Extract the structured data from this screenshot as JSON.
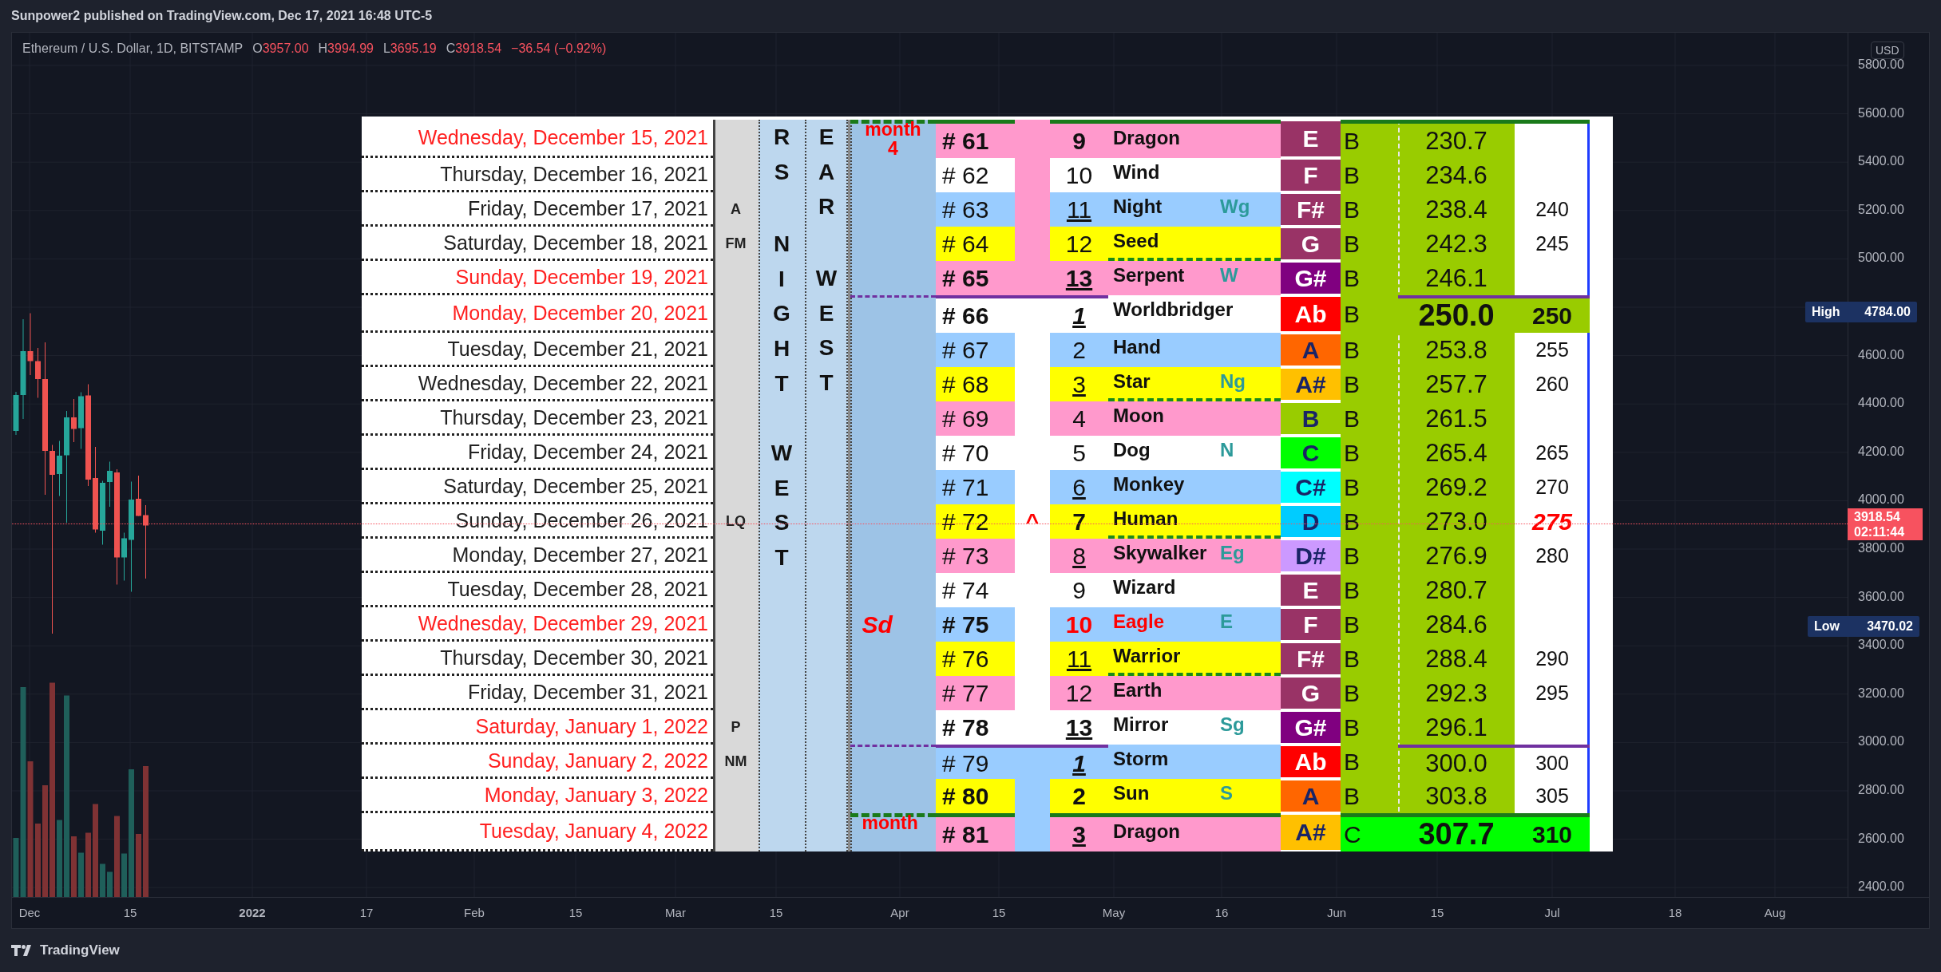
{
  "header": {
    "title": "Sunpower2 published on TradingView.com, Dec 17, 2021 16:48 UTC-5"
  },
  "legend": {
    "symbol": "Ethereum / U.S. Dollar, 1D, BITSTAMP",
    "values": [
      {
        "label": "O",
        "value": "3957.00"
      },
      {
        "label": "H",
        "value": "3994.99"
      },
      {
        "label": "L",
        "value": "3695.19"
      },
      {
        "label": "C",
        "value": "3918.54"
      }
    ],
    "change": "−36.54 (−0.92%)"
  },
  "price_axis": {
    "currency": "USD",
    "labels": [
      "5800.00",
      "5600.00",
      "5400.00",
      "5200.00",
      "5000.00",
      "4600.00",
      "4400.00",
      "4200.00",
      "4000.00",
      "3800.00",
      "3600.00",
      "3400.00",
      "3200.00",
      "3000.00",
      "2800.00",
      "2600.00",
      "2400.00"
    ],
    "high": {
      "label": "High",
      "value": "4784.00"
    },
    "last": {
      "price": "3918.54",
      "countdown": "02:11:44"
    },
    "low": {
      "label": "Low",
      "value": "3470.02"
    }
  },
  "time_axis": {
    "labels": [
      {
        "text": "Dec",
        "bold": false
      },
      {
        "text": "15",
        "bold": false
      },
      {
        "text": "2022",
        "bold": true
      },
      {
        "text": "17",
        "bold": false
      },
      {
        "text": "Feb",
        "bold": false
      },
      {
        "text": "15",
        "bold": false
      },
      {
        "text": "Mar",
        "bold": false
      },
      {
        "text": "15",
        "bold": false
      },
      {
        "text": "Apr",
        "bold": false
      },
      {
        "text": "15",
        "bold": false
      },
      {
        "text": "May",
        "bold": false
      },
      {
        "text": "16",
        "bold": false
      },
      {
        "text": "Jun",
        "bold": false
      },
      {
        "text": "15",
        "bold": false
      },
      {
        "text": "Jul",
        "bold": false
      },
      {
        "text": "18",
        "bold": false
      },
      {
        "text": "Aug",
        "bold": false
      }
    ]
  },
  "table": {
    "vertical_columns": [
      {
        "words": [
          "RS",
          "NIGHT",
          "WEST"
        ]
      },
      {
        "words": [
          "EAR",
          "WEST"
        ]
      }
    ],
    "rows": [
      {
        "kind": "month",
        "date": "Wednesday, December 15, 2021",
        "date_red": true,
        "side": "month 4",
        "hash": "# 61",
        "hash_bold": true,
        "mark": {
          "color": "#ff99cc"
        },
        "num": "9",
        "num_bold": true,
        "num_underline": false,
        "num_italic": false,
        "name": "Dragon",
        "accent": false,
        "color": "#ff99cc",
        "note": {
          "text": "E",
          "color": "#993366"
        },
        "letter": "B",
        "value": "230.7",
        "value_bold": false
      },
      {
        "kind": "day",
        "date": "Thursday, December 16, 2021",
        "date_red": false,
        "hash": "# 62",
        "hash_bold": false,
        "mark": {
          "color": "#ff99cc"
        },
        "num": "10",
        "num_bold": false,
        "num_underline": false,
        "num_italic": false,
        "name": "Wind",
        "accent": false,
        "color": "#ffffff",
        "note": {
          "text": "F",
          "color": "#993366"
        },
        "letter": "B",
        "value": "234.6",
        "value_bold": false
      },
      {
        "kind": "day",
        "date": "Friday, December 17, 2021",
        "date_red": false,
        "phase": "A",
        "hash": "# 63",
        "hash_bold": false,
        "mark": {
          "color": "#ff99cc"
        },
        "num": "11",
        "num_bold": false,
        "num_underline": true,
        "num_italic": false,
        "name": "Night",
        "tag": "Wg",
        "accent": false,
        "color": "#99ccff",
        "note": {
          "text": "F#",
          "color": "#993366"
        },
        "letter": "B",
        "value": "238.4",
        "value_bold": false,
        "target": "240",
        "target_bold": false,
        "target_red": false
      },
      {
        "kind": "day",
        "date": "Saturday, December 18, 2021",
        "date_red": false,
        "phase": "FM",
        "hash": "# 64",
        "hash_bold": false,
        "mark": {
          "color": "#ff99cc"
        },
        "num": "12",
        "num_bold": false,
        "num_underline": false,
        "num_italic": false,
        "name": "Seed",
        "accent": false,
        "color": "#ffff00",
        "note": {
          "text": "G",
          "color": "#993366"
        },
        "letter": "B",
        "value": "242.3",
        "value_bold": false,
        "target": "245",
        "target_bold": false,
        "target_red": false
      },
      {
        "kind": "day",
        "date": "Sunday, December 19, 2021",
        "date_red": true,
        "hash": "# 65",
        "hash_bold": true,
        "mark": {
          "color": "#ff99cc"
        },
        "num": "13",
        "num_bold": true,
        "num_underline": true,
        "num_italic": false,
        "name": "Serpent",
        "tag": "W",
        "accent": false,
        "color": "#ff99cc",
        "note": {
          "text": "G#",
          "color": "#800080"
        },
        "letter": "B",
        "value": "246.1",
        "value_bold": false
      },
      {
        "kind": "cycle",
        "date": "Monday, December 20, 2021",
        "date_red": true,
        "hash": "# 66",
        "hash_bold": true,
        "num": "1",
        "num_bold": true,
        "num_underline": true,
        "num_italic": true,
        "name": "Worldbridger",
        "accent": false,
        "color": "#ffffff",
        "note": {
          "text": "Ab",
          "color": "#ff0000"
        },
        "letter": "B",
        "value": "250.0",
        "value_bold": true,
        "target": "250",
        "target_bold": true,
        "target_red": false,
        "highlight": {
          "color": "#99cc00"
        }
      },
      {
        "kind": "day",
        "date": "Tuesday, December 21, 2021",
        "date_red": false,
        "hash": "# 67",
        "hash_bold": false,
        "num": "2",
        "num_bold": false,
        "num_underline": false,
        "num_italic": false,
        "name": "Hand",
        "accent": false,
        "color": "#99ccff",
        "note": {
          "text": "A",
          "color": "#ff6600"
        },
        "letter": "B",
        "value": "253.8",
        "value_bold": false,
        "target": "255",
        "target_bold": false,
        "target_red": false
      },
      {
        "kind": "day",
        "date": "Wednesday, December 22, 2021",
        "date_red": false,
        "hash": "# 68",
        "hash_bold": false,
        "num": "3",
        "num_bold": false,
        "num_underline": true,
        "num_italic": false,
        "name": "Star",
        "tag": "Ng",
        "accent": false,
        "color": "#ffff00",
        "note": {
          "text": "A#",
          "color": "#ffc000"
        },
        "letter": "B",
        "value": "257.7",
        "value_bold": false,
        "target": "260",
        "target_bold": false,
        "target_red": false
      },
      {
        "kind": "day",
        "date": "Thursday, December 23, 2021",
        "date_red": false,
        "hash": "# 69",
        "hash_bold": false,
        "num": "4",
        "num_bold": false,
        "num_underline": false,
        "num_italic": false,
        "name": "Moon",
        "accent": false,
        "color": "#ff99cc",
        "note": {
          "text": "B",
          "color": "#99cc00"
        },
        "letter": "B",
        "value": "261.5",
        "value_bold": false
      },
      {
        "kind": "day",
        "date": "Friday, December 24, 2021",
        "date_red": false,
        "hash": "# 70",
        "hash_bold": false,
        "num": "5",
        "num_bold": false,
        "num_underline": false,
        "num_italic": false,
        "name": "Dog",
        "tag": "N",
        "accent": false,
        "color": "#ffffff",
        "note": {
          "text": "C",
          "color": "#00ff00"
        },
        "letter": "B",
        "value": "265.4",
        "value_bold": false,
        "target": "265",
        "target_bold": false,
        "target_red": false
      },
      {
        "kind": "day",
        "date": "Saturday, December 25, 2021",
        "date_red": false,
        "hash": "# 71",
        "hash_bold": false,
        "num": "6",
        "num_bold": false,
        "num_underline": true,
        "num_italic": false,
        "name": "Monkey",
        "accent": false,
        "color": "#99ccff",
        "note": {
          "text": "C#",
          "color": "#00ffff"
        },
        "letter": "B",
        "value": "269.2",
        "value_bold": false,
        "target": "270",
        "target_bold": false,
        "target_red": false
      },
      {
        "kind": "day",
        "date": "Sunday, December 26, 2021",
        "date_red": false,
        "phase": "LQ",
        "hash": "# 72",
        "hash_bold": false,
        "mark": {
          "text": "^"
        },
        "num": "7",
        "num_bold": true,
        "num_underline": false,
        "num_italic": false,
        "name": "Human",
        "accent": false,
        "color": "#ffff00",
        "note": {
          "text": "D",
          "color": "#00ccff"
        },
        "letter": "B",
        "value": "273.0",
        "value_bold": false,
        "target": "275",
        "target_bold": true,
        "target_red": true
      },
      {
        "kind": "day",
        "date": "Monday, December 27, 2021",
        "date_red": false,
        "hash": "# 73",
        "hash_bold": false,
        "num": "8",
        "num_bold": false,
        "num_underline": true,
        "num_italic": false,
        "name": "Skywalker",
        "tag": "Eg",
        "accent": false,
        "color": "#ff99cc",
        "note": {
          "text": "D#",
          "color": "#cc99ff"
        },
        "letter": "B",
        "value": "276.9",
        "value_bold": false,
        "target": "280",
        "target_bold": false,
        "target_red": false
      },
      {
        "kind": "day",
        "date": "Tuesday, December 28, 2021",
        "date_red": false,
        "hash": "# 74",
        "hash_bold": false,
        "num": "9",
        "num_bold": false,
        "num_underline": false,
        "num_italic": false,
        "name": "Wizard",
        "accent": false,
        "color": "#ffffff",
        "note": {
          "text": "E",
          "color": "#993366"
        },
        "letter": "B",
        "value": "280.7",
        "value_bold": false
      },
      {
        "kind": "day",
        "date": "Wednesday, December 29, 2021",
        "date_red": true,
        "side": "Sd",
        "hash": "# 75",
        "hash_bold": true,
        "num": "10",
        "num_bold": true,
        "num_underline": false,
        "num_italic": false,
        "name": "Eagle",
        "tag": "E",
        "accent": true,
        "color": "#99ccff",
        "note": {
          "text": "F",
          "color": "#993366"
        },
        "letter": "B",
        "value": "284.6",
        "value_bold": false
      },
      {
        "kind": "day",
        "date": "Thursday, December 30, 2021",
        "date_red": false,
        "hash": "# 76",
        "hash_bold": false,
        "num": "11",
        "num_bold": false,
        "num_underline": true,
        "num_italic": false,
        "name": "Warrior",
        "accent": false,
        "color": "#ffff00",
        "note": {
          "text": "F#",
          "color": "#993366"
        },
        "letter": "B",
        "value": "288.4",
        "value_bold": false,
        "target": "290",
        "target_bold": false,
        "target_red": false
      },
      {
        "kind": "day",
        "date": "Friday, December 31, 2021",
        "date_red": false,
        "hash": "# 77",
        "hash_bold": false,
        "num": "12",
        "num_bold": false,
        "num_underline": false,
        "num_italic": false,
        "name": "Earth",
        "accent": false,
        "color": "#ff99cc",
        "note": {
          "text": "G",
          "color": "#993366"
        },
        "letter": "B",
        "value": "292.3",
        "value_bold": false,
        "target": "295",
        "target_bold": false,
        "target_red": false
      },
      {
        "kind": "day",
        "date": "Saturday, January 1, 2022",
        "date_red": true,
        "phase": "P",
        "hash": "# 78",
        "hash_bold": true,
        "num": "13",
        "num_bold": true,
        "num_underline": true,
        "num_italic": false,
        "name": "Mirror",
        "tag": "Sg",
        "accent": false,
        "color": "#ffffff",
        "note": {
          "text": "G#",
          "color": "#800080"
        },
        "letter": "B",
        "value": "296.1",
        "value_bold": false
      },
      {
        "kind": "cycle",
        "date": "Sunday, January 2, 2022",
        "date_red": true,
        "phase": "NM",
        "hash": "# 79",
        "hash_bold": false,
        "mark": {
          "color": "#99ccff"
        },
        "num": "1",
        "num_bold": true,
        "num_underline": true,
        "num_italic": true,
        "name": "Storm",
        "accent": false,
        "color": "#99ccff",
        "note": {
          "text": "Ab",
          "color": "#ff0000"
        },
        "letter": "B",
        "value": "300.0",
        "value_bold": false,
        "target": "300",
        "target_bold": false,
        "target_red": false
      },
      {
        "kind": "day",
        "date": "Monday, January 3, 2022",
        "date_red": true,
        "hash": "# 80",
        "hash_bold": true,
        "mark": {
          "color": "#99ccff"
        },
        "num": "2",
        "num_bold": true,
        "num_underline": false,
        "num_italic": false,
        "name": "Sun",
        "tag": "S",
        "accent": false,
        "color": "#ffff00",
        "note": {
          "text": "A",
          "color": "#ff6600"
        },
        "letter": "B",
        "value": "303.8",
        "value_bold": false,
        "target": "305",
        "target_bold": false,
        "target_red": false
      },
      {
        "kind": "month",
        "date": "Tuesday, January 4, 2022",
        "date_red": true,
        "side": "month",
        "hash": "# 81",
        "hash_bold": true,
        "mark": {
          "color": "#99ccff"
        },
        "num": "3",
        "num_bold": true,
        "num_underline": true,
        "num_italic": false,
        "name": "Dragon",
        "accent": false,
        "color": "#ff99cc",
        "note": {
          "text": "A#",
          "color": "#ffc000"
        },
        "letter": "C",
        "value": "307.7",
        "value_bold": true,
        "target": "310",
        "target_bold": true,
        "target_red": false,
        "highlight": {
          "color": "#00ff00"
        }
      }
    ]
  },
  "footer": {
    "brand": "TradingView"
  }
}
